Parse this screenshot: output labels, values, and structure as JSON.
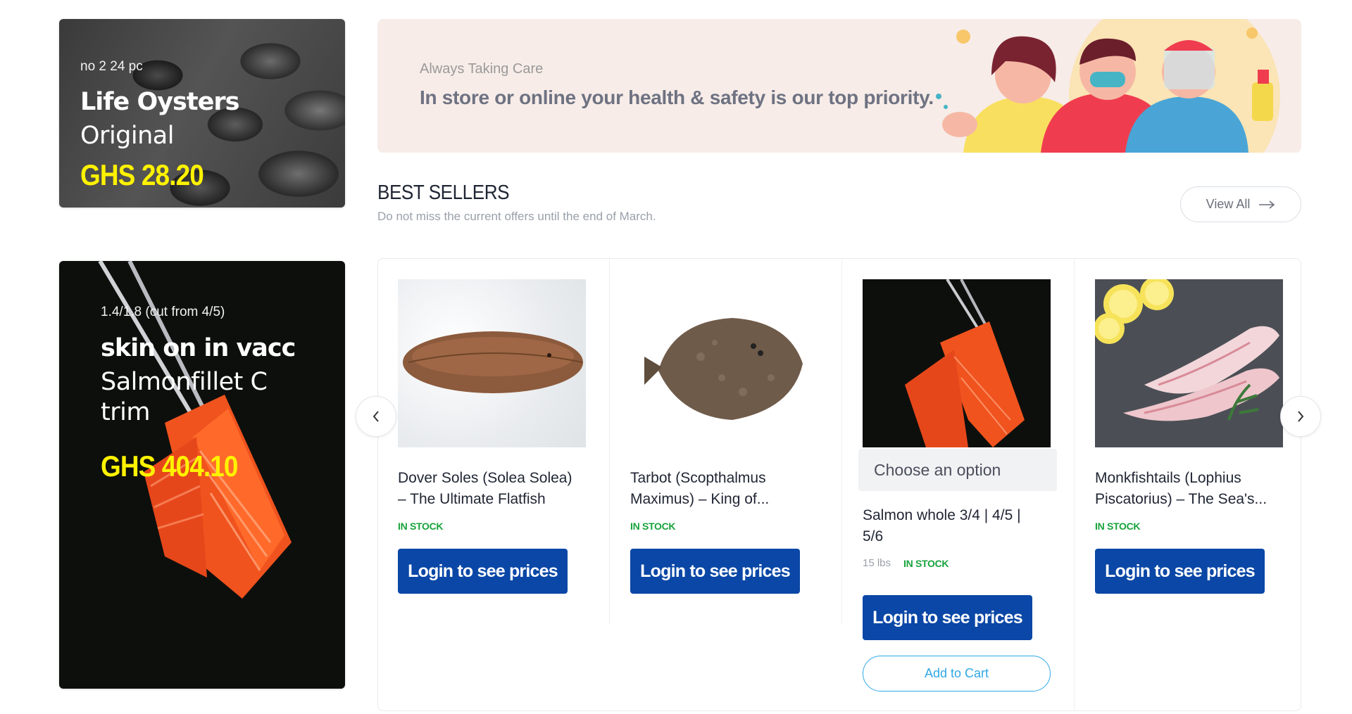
{
  "promos": [
    {
      "small": "no 2 24 pc",
      "title_line1": "Life Oysters",
      "title_line2": "Original",
      "price": "GHS 28.20"
    },
    {
      "small": "1.4/1.8 (cut from 4/5)",
      "title_line1": "skin on in vacc",
      "title_line2": "Salmonfillet C",
      "title_line3": "trim",
      "price": "GHS 404.10"
    }
  ],
  "banner": {
    "kicker": "Always Taking Care",
    "headline": "In store or online your health & safety is our top priority."
  },
  "best_sellers": {
    "title": "BEST SELLERS",
    "subtitle": "Do not miss the current offers until the end of March.",
    "view_all_label": "View All"
  },
  "products": [
    {
      "name_line1": "Dover Soles (Solea Solea)",
      "name_line2": "– The Ultimate Flatfish",
      "stock": "IN STOCK",
      "button": "Login to see prices"
    },
    {
      "name_line1": "Tarbot (Scopthalmus",
      "name_line2": "Maximus) – King of...",
      "stock": "IN STOCK",
      "button": "Login to see prices"
    },
    {
      "option_placeholder": "Choose an option",
      "name_line1": "Salmon whole 3/4 | 4/5 |",
      "name_line2": "5/6",
      "weight": "15 lbs",
      "stock": "IN STOCK",
      "button": "Login to see prices",
      "add_to_cart": "Add to Cart"
    },
    {
      "name_line1": "Monkfishtails (Lophius",
      "name_line2": "Piscatorius) – The Sea's...",
      "stock": "IN STOCK",
      "button": "Login to see prices"
    }
  ],
  "colors": {
    "price_yellow": "#fff200",
    "button_blue": "#0a47a6",
    "stock_green": "#18a33c",
    "cart_outline": "#2fa8e6",
    "banner_bg": "#f7ece8"
  },
  "icons": {
    "prev": "chevron-left-icon",
    "next": "chevron-right-icon",
    "view_all": "arrow-right-icon"
  }
}
